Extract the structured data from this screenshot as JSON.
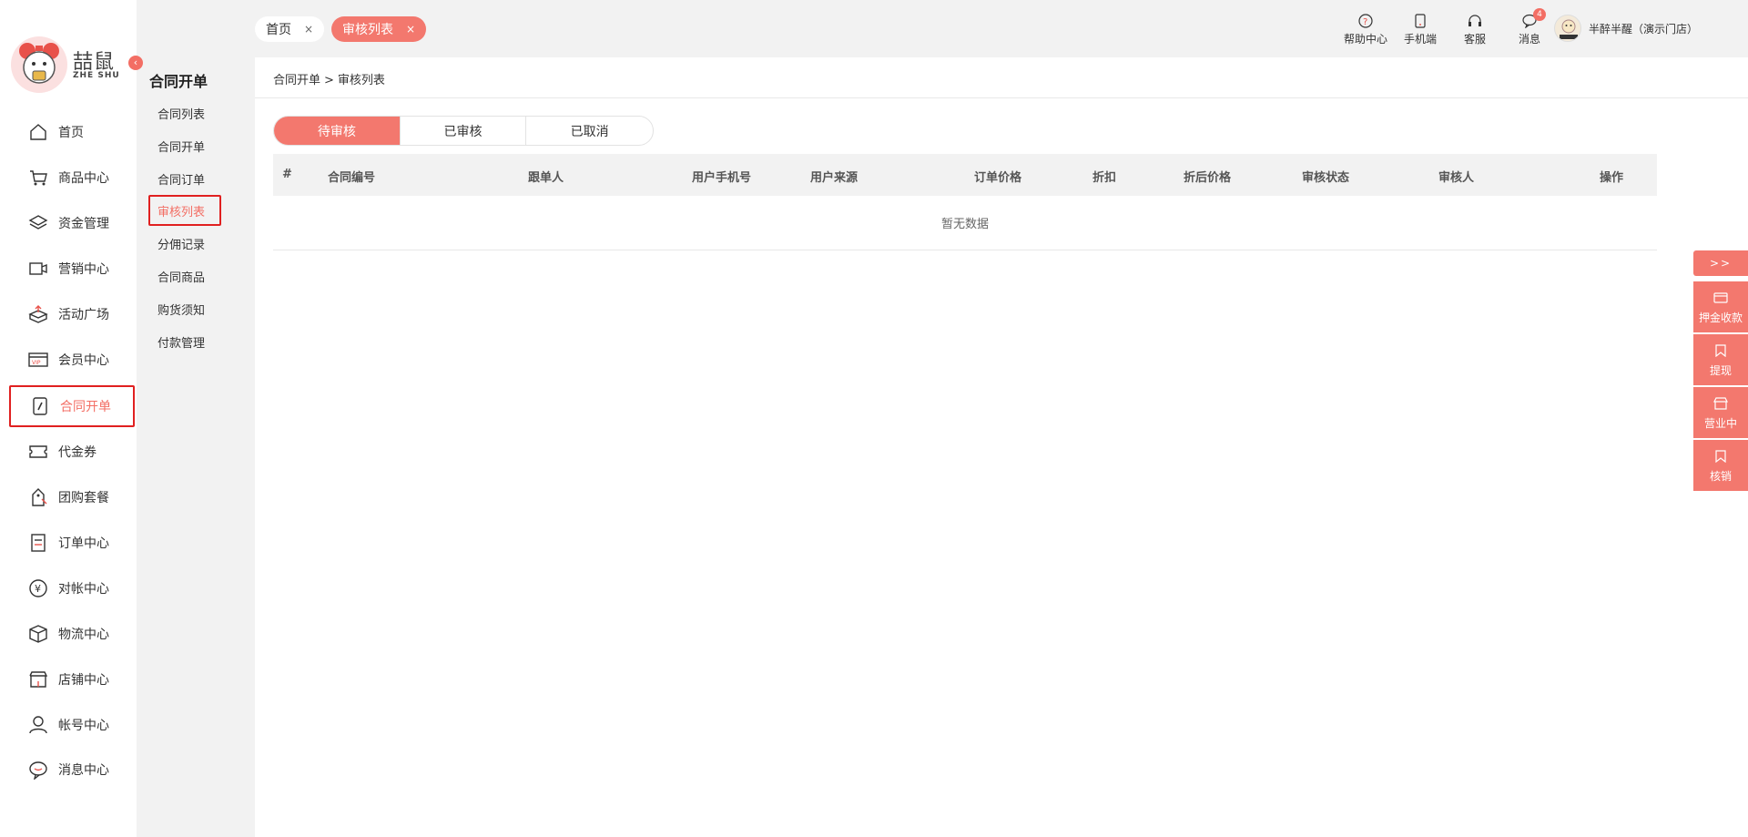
{
  "logo": {
    "brand": "喆鼠",
    "brand_sub": "ZHE SHU"
  },
  "sidebar": {
    "collapse_icon": "chevron-left-icon",
    "items": [
      {
        "label": "首页",
        "icon": "home-icon"
      },
      {
        "label": "商品中心",
        "icon": "cart-icon"
      },
      {
        "label": "资金管理",
        "icon": "layers-icon"
      },
      {
        "label": "营销中心",
        "icon": "marketing-icon"
      },
      {
        "label": "活动广场",
        "icon": "box-arrow-icon"
      },
      {
        "label": "会员中心",
        "icon": "vip-card-icon"
      },
      {
        "label": "合同开单",
        "icon": "contract-icon"
      },
      {
        "label": "代金券",
        "icon": "ticket-icon"
      },
      {
        "label": "团购套餐",
        "icon": "tag-icon"
      },
      {
        "label": "订单中心",
        "icon": "order-icon"
      },
      {
        "label": "对帐中心",
        "icon": "yen-icon"
      },
      {
        "label": "物流中心",
        "icon": "package-icon"
      },
      {
        "label": "店铺中心",
        "icon": "store-icon"
      },
      {
        "label": "帐号中心",
        "icon": "user-icon"
      },
      {
        "label": "消息中心",
        "icon": "chat-icon"
      }
    ],
    "active_index": 6
  },
  "subnav": {
    "title": "合同开单",
    "items": [
      "合同列表",
      "合同开单",
      "合同订单",
      "审核列表",
      "分佣记录",
      "合同商品",
      "购货须知",
      "付款管理"
    ],
    "active_index": 3
  },
  "header": {
    "tabs": [
      {
        "label": "首页",
        "close": "×"
      },
      {
        "label": "审核列表",
        "close": "×"
      }
    ],
    "tools": [
      {
        "label": "帮助中心",
        "icon": "help-icon"
      },
      {
        "label": "手机端",
        "icon": "mobile-icon"
      },
      {
        "label": "客服",
        "icon": "headset-icon"
      },
      {
        "label": "消息",
        "icon": "message-icon",
        "badge": "4"
      }
    ],
    "user": {
      "name": "半醉半醒（演示门店）"
    }
  },
  "main": {
    "breadcrumb": {
      "parent": "合同开单",
      "sep": ">",
      "current": "审核列表"
    },
    "status_tabs": [
      "待审核",
      "已审核",
      "已取消"
    ],
    "status_active": 0,
    "table": {
      "columns": [
        "#",
        "合同编号",
        "跟单人",
        "用户手机号",
        "用户来源",
        "订单价格",
        "折扣",
        "折后价格",
        "审核状态",
        "审核人",
        "操作"
      ],
      "empty_text": "暂无数据"
    }
  },
  "float_panel": {
    "toggle": ">>",
    "items": [
      {
        "label": "押金收款",
        "icon": "card-icon"
      },
      {
        "label": "提现",
        "icon": "bookmark-icon"
      },
      {
        "label": "营业中",
        "icon": "shop-icon"
      },
      {
        "label": "核销",
        "icon": "bookmark-icon"
      }
    ]
  },
  "colors": {
    "accent": "#f3786e",
    "highlight_border": "#e02020",
    "background": "#f2f2f2"
  }
}
